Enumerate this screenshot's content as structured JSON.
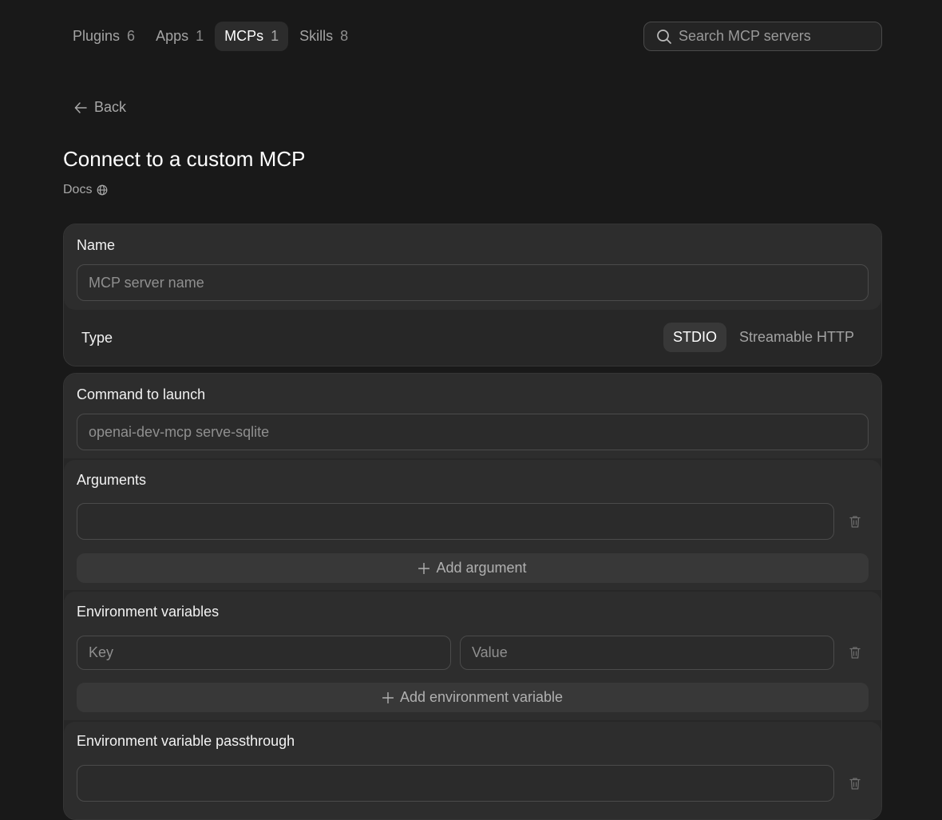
{
  "tabs": [
    {
      "label": "Plugins",
      "count": "6",
      "active": false
    },
    {
      "label": "Apps",
      "count": "1",
      "active": false
    },
    {
      "label": "MCPs",
      "count": "1",
      "active": true
    },
    {
      "label": "Skills",
      "count": "8",
      "active": false
    }
  ],
  "search": {
    "placeholder": "Search MCP servers",
    "icon": "search-icon"
  },
  "back": {
    "label": "Back",
    "icon": "arrow-left-icon"
  },
  "title": "Connect to a custom MCP",
  "docs": {
    "label": "Docs",
    "icon": "globe-icon"
  },
  "form": {
    "name": {
      "label": "Name",
      "placeholder": "MCP server name",
      "value": ""
    },
    "type": {
      "label": "Type",
      "options": [
        "STDIO",
        "Streamable HTTP"
      ],
      "selected": "STDIO"
    },
    "command": {
      "label": "Command to launch",
      "placeholder": "openai-dev-mcp serve-sqlite",
      "value": ""
    },
    "arguments": {
      "label": "Arguments",
      "value": "",
      "add_label": "Add argument"
    },
    "env": {
      "label": "Environment variables",
      "key_placeholder": "Key",
      "value_placeholder": "Value",
      "add_label": "Add environment variable"
    },
    "passthrough": {
      "label": "Environment variable passthrough",
      "value": ""
    }
  },
  "colors": {
    "background": "#191919",
    "card": "#272727",
    "section": "#2d2d2d",
    "active_tab": "#2c2c2c"
  }
}
